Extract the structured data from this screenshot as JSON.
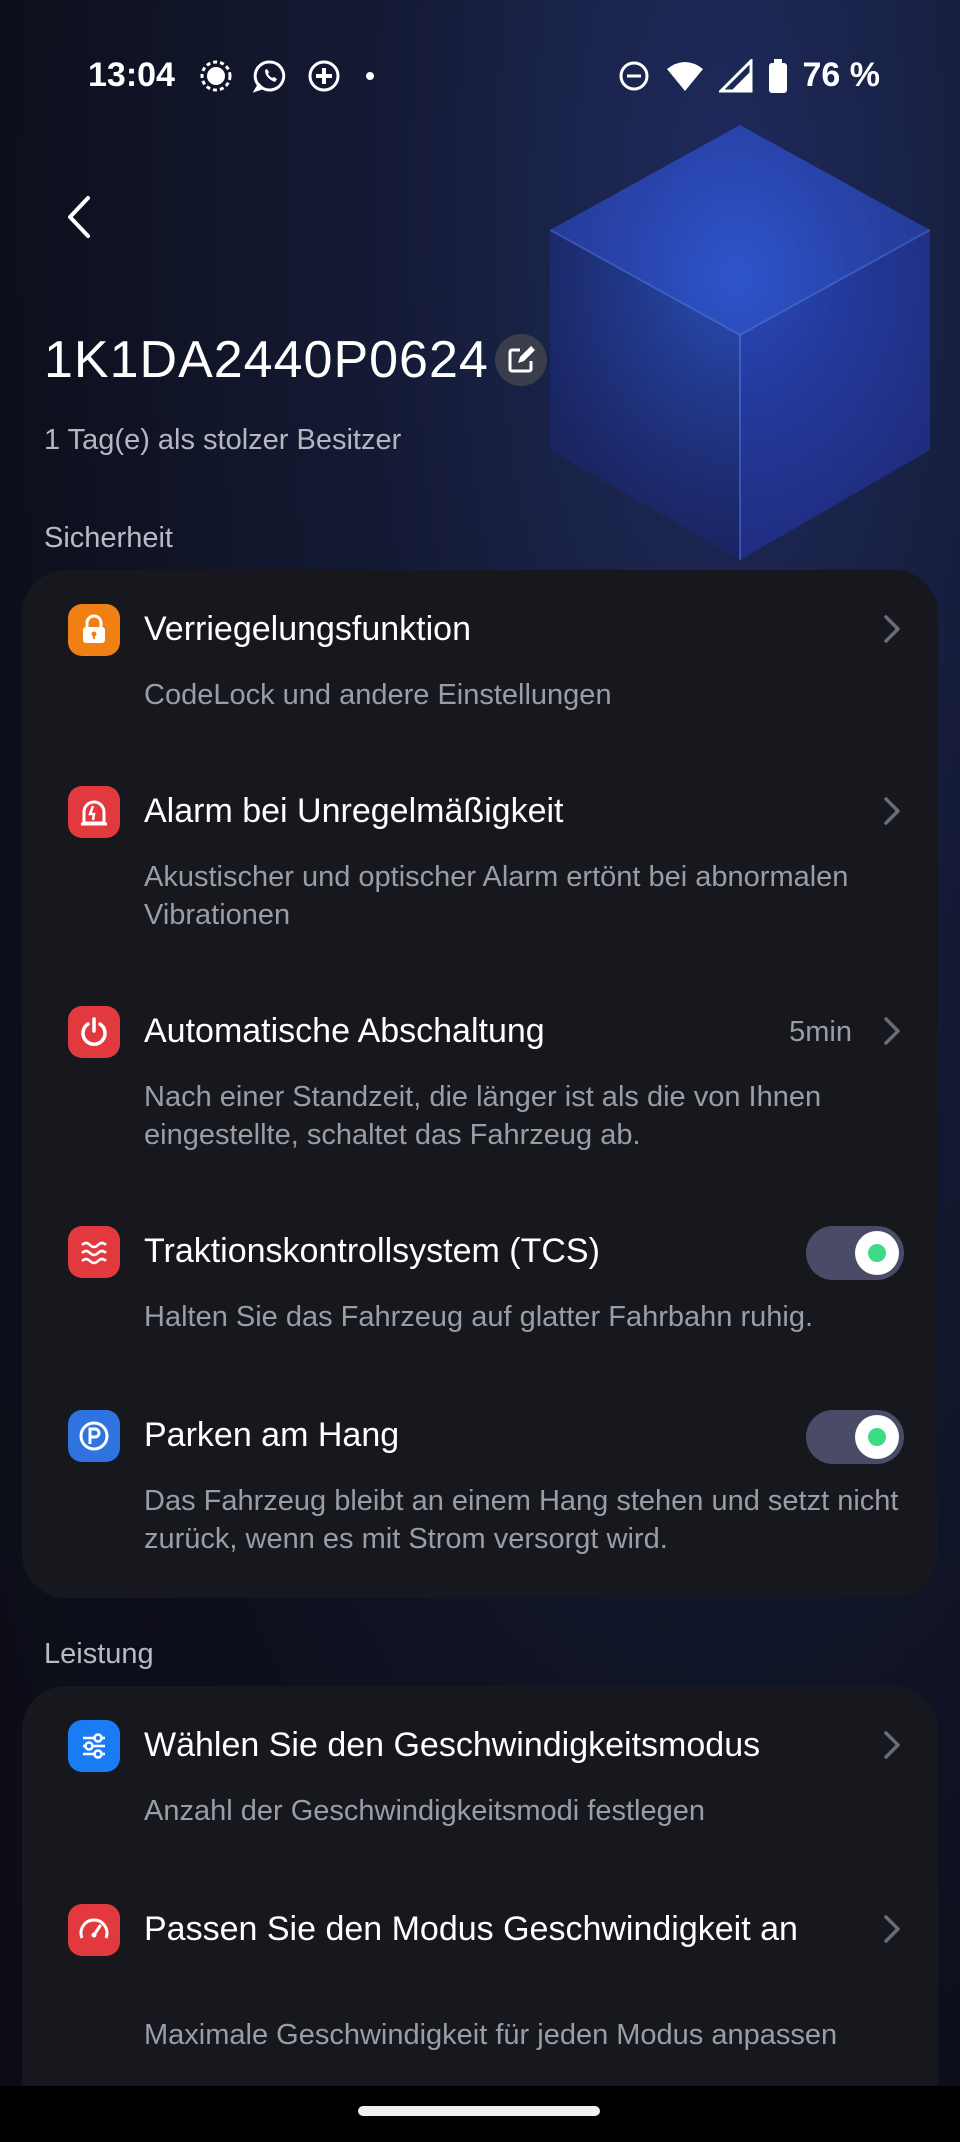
{
  "status_bar": {
    "time": "13:04",
    "battery": "76 %"
  },
  "header": {
    "device_name": "1K1DA2440P0624",
    "ownership": "1 Tag(e) als stolzer Besitzer"
  },
  "sections": {
    "security": {
      "label": "Sicherheit",
      "items": [
        {
          "title": "Verriegelungsfunktion",
          "desc": "CodeLock und andere Einstellungen",
          "icon": "lock-icon",
          "icon_color": "#f07f14"
        },
        {
          "title": "Alarm bei Unregelmäßigkeit",
          "desc": "Akustischer und optischer Alarm ertönt bei abnormalen Vibrationen",
          "icon": "alarm-icon",
          "icon_color": "#e2393f"
        },
        {
          "title": "Automatische Abschaltung",
          "value": "5min",
          "desc": "Nach einer Standzeit, die länger ist als die von Ihnen eingestellte, schaltet das Fahrzeug ab.",
          "icon": "power-icon",
          "icon_color": "#e2393f"
        },
        {
          "title": "Traktionskontrollsystem (TCS)",
          "desc": "Halten Sie das Fahrzeug auf glatter Fahrbahn ruhig.",
          "icon": "waves-icon",
          "icon_color": "#e2393f",
          "toggle": true
        },
        {
          "title": "Parken am Hang",
          "desc": "Das Fahrzeug bleibt an einem Hang stehen und setzt nicht zurück, wenn es mit Strom versorgt wird.",
          "icon": "parking-icon",
          "icon_color": "#2f73e0",
          "toggle": true
        }
      ]
    },
    "performance": {
      "label": "Leistung",
      "items": [
        {
          "title": "Wählen Sie den Geschwindigkeitsmodus",
          "desc": "Anzahl der Geschwindigkeitsmodi festlegen",
          "icon": "sliders-icon",
          "icon_color": "#1a7cf5"
        },
        {
          "title": "Passen Sie den Modus Geschwindigkeit an",
          "desc": "Maximale Geschwindigkeit für jeden Modus anpassen",
          "icon": "speedometer-icon",
          "icon_color": "#e2393f"
        }
      ]
    }
  }
}
